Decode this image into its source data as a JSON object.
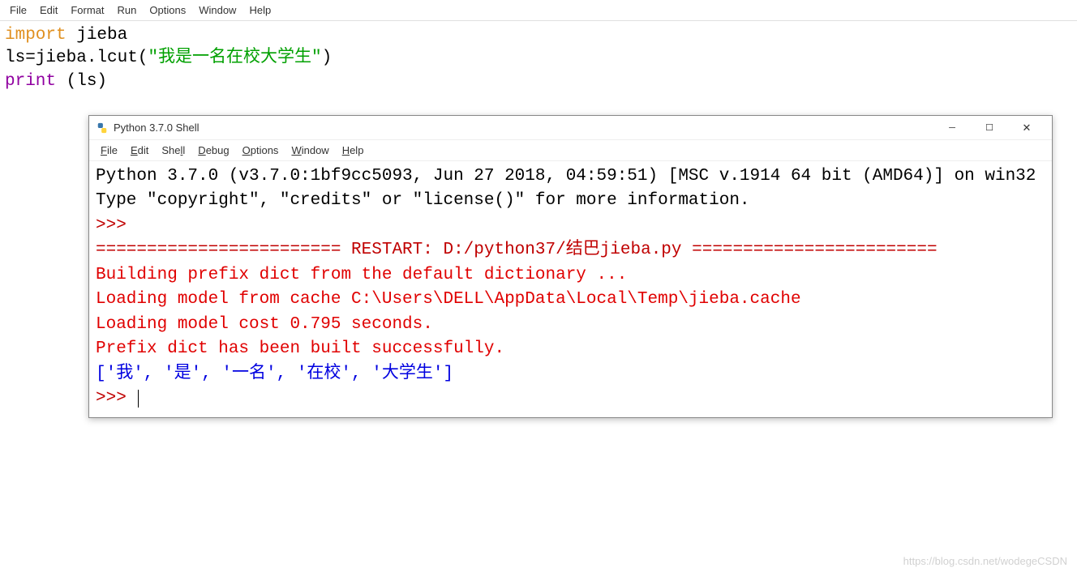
{
  "editor": {
    "menu": {
      "file": "File",
      "edit": "Edit",
      "format": "Format",
      "run": "Run",
      "options": "Options",
      "window": "Window",
      "help": "Help"
    },
    "code": {
      "line1_import": "import",
      "line1_rest": " jieba",
      "line2_plain1": "ls=jieba.lcut(",
      "line2_str": "\"我是一名在校大学生\"",
      "line2_plain2": ")",
      "line3_print": "print",
      "line3_rest": " (ls)"
    }
  },
  "shell": {
    "title": "Python 3.7.0 Shell",
    "menu": {
      "file": "File",
      "edit": "Edit",
      "shell": "Shell",
      "debug": "Debug",
      "options": "Options",
      "window": "Window",
      "help": "Help"
    },
    "banner": "Python 3.7.0 (v3.7.0:1bf9cc5093, Jun 27 2018, 04:59:51) [MSC v.1914 64 bit (AMD64)] on win32\nType \"copyright\", \"credits\" or \"license()\" for more information.",
    "prompt1": ">>> ",
    "restart_line": "======================== RESTART: D:/python37/结巴jieba.py ========================",
    "stderr": "Building prefix dict from the default dictionary ...\nLoading model from cache C:\\Users\\DELL\\AppData\\Local\\Temp\\jieba.cache\nLoading model cost 0.795 seconds.\nPrefix dict has been built successfully.",
    "output": "['我', '是', '一名', '在校', '大学生']",
    "prompt2": ">>> "
  },
  "watermark": "https://blog.csdn.net/wodegeCSDN"
}
